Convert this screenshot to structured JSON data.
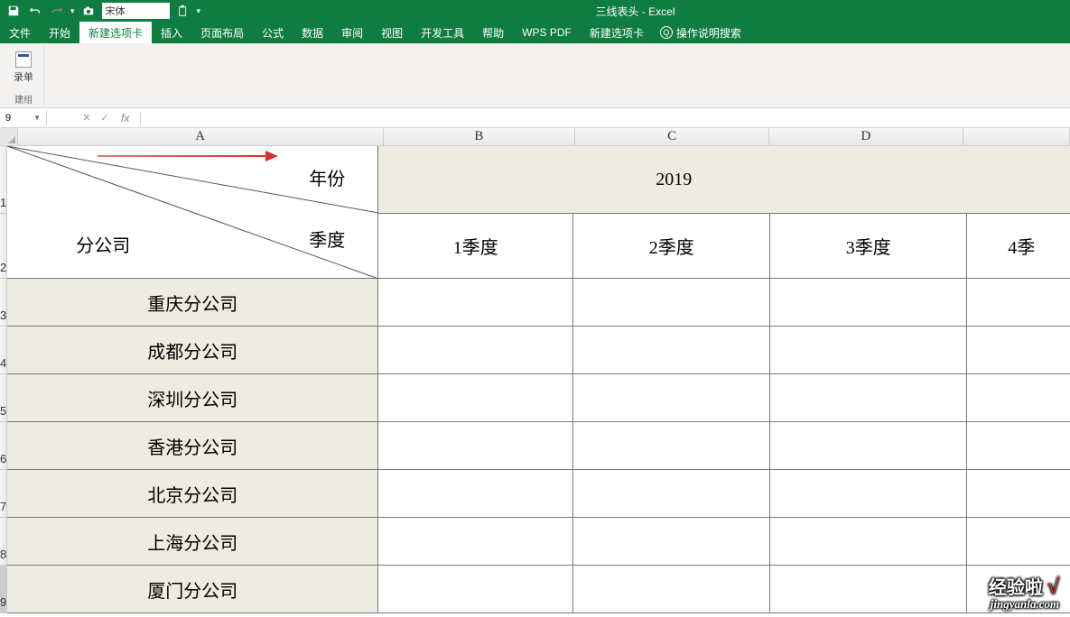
{
  "titlebar": {
    "font_name": "宋体",
    "title": "三线表头 - Excel"
  },
  "ribbon": {
    "tabs": [
      "文件",
      "开始",
      "新建选项卡",
      "插入",
      "页面布局",
      "公式",
      "数据",
      "审阅",
      "视图",
      "开发工具",
      "帮助",
      "WPS PDF",
      "新建选项卡"
    ],
    "active_index": 2,
    "tell_me": "操作说明搜索",
    "record_btn": "录单",
    "group_label": "建组"
  },
  "namebox": "9",
  "columns": [
    "A",
    "B",
    "C",
    "D"
  ],
  "rows": [
    "1",
    "2",
    "3",
    "4",
    "5",
    "6",
    "7",
    "8",
    "9"
  ],
  "header_cell": {
    "year": "年份",
    "quarter": "季度",
    "company": "分公司"
  },
  "year_value": "2019",
  "quarters": [
    "1季度",
    "2季度",
    "3季度",
    "4季"
  ],
  "companies": [
    "重庆分公司",
    "成都分公司",
    "深圳分公司",
    "香港分公司",
    "北京分公司",
    "上海分公司",
    "厦门分公司"
  ],
  "watermark": {
    "text": "经验啦",
    "url": "jingyanla.com"
  }
}
